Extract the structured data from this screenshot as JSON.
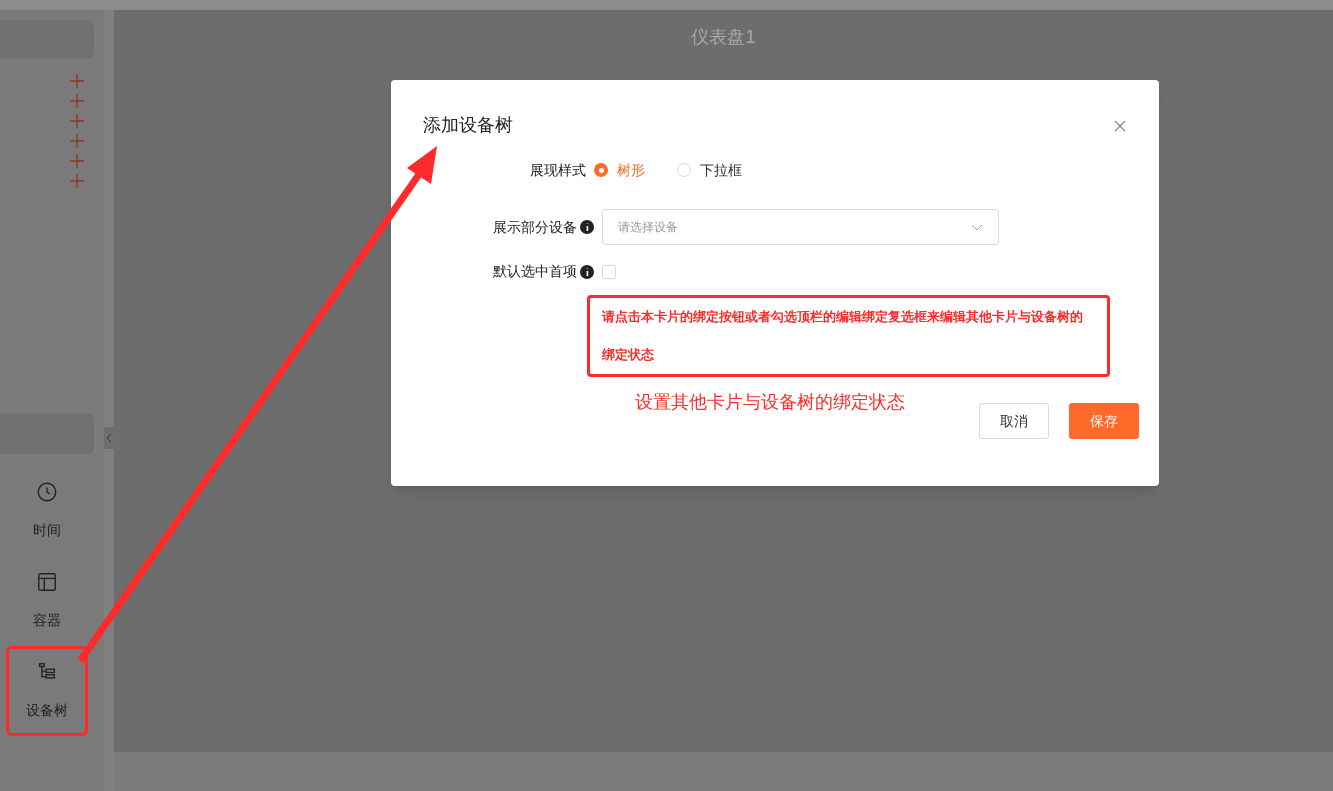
{
  "sidebar": {
    "items": [
      {
        "kind": "clock",
        "label": "时间",
        "annotated": false
      },
      {
        "kind": "layout",
        "label": "容器",
        "annotated": false
      },
      {
        "kind": "tree",
        "label": "设备树",
        "annotated": true
      }
    ]
  },
  "canvas": {
    "title": "仪表盘1"
  },
  "dialog": {
    "title": "添加设备树",
    "display_style": {
      "label": "展现样式",
      "options": [
        {
          "label": "树形",
          "selected": true
        },
        {
          "label": "下拉框",
          "selected": false
        }
      ]
    },
    "partial_devices": {
      "label": "展示部分设备",
      "placeholder": "请选择设备"
    },
    "default_first": {
      "label": "默认选中首项",
      "checked": false
    },
    "note": "请点击本卡片的绑定按钮或者勾选顶栏的编辑绑定复选框来编辑其他卡片与设备树的绑定状态",
    "annotation": "设置其他卡片与设备树的绑定状态",
    "buttons": {
      "cancel": "取消",
      "save": "保存"
    }
  }
}
